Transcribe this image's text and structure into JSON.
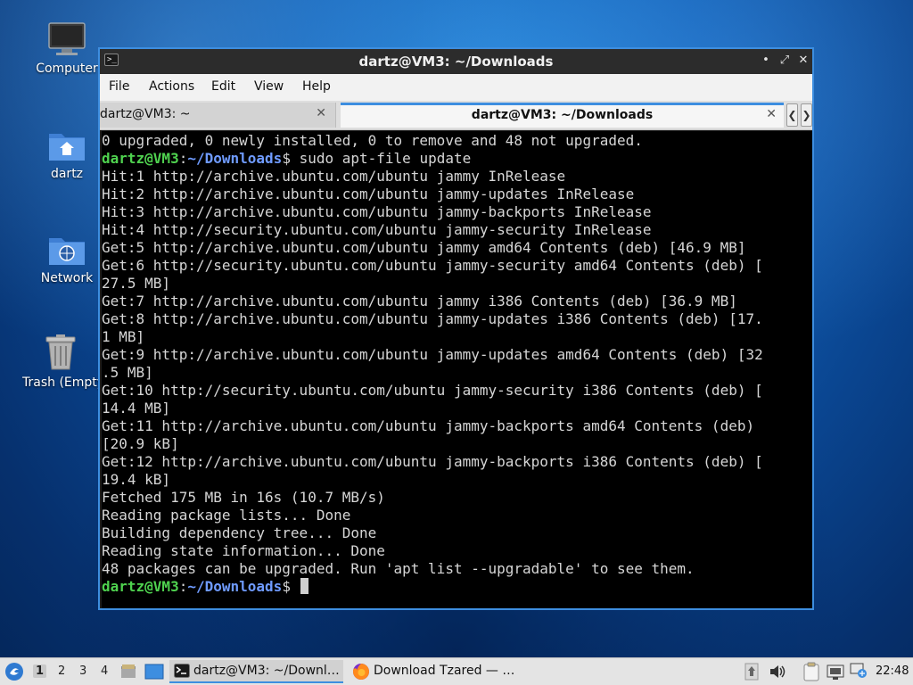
{
  "desktop": {
    "icons": [
      {
        "label": "Computer",
        "icon": "computer-icon"
      },
      {
        "label": "dartz",
        "icon": "home-folder-icon"
      },
      {
        "label": "Network",
        "icon": "network-folder-icon"
      },
      {
        "label": "Trash (Empty)",
        "icon": "trash-icon"
      }
    ]
  },
  "window": {
    "title": "dartz@VM3: ~/Downloads",
    "menu": [
      "File",
      "Actions",
      "Edit",
      "View",
      "Help"
    ],
    "tabs": [
      {
        "label": "dartz@VM3: ~",
        "active": false
      },
      {
        "label": "dartz@VM3: ~/Downloads",
        "active": true
      }
    ],
    "prompt": {
      "user_host": "dartz@VM3",
      "separator": ":",
      "path": "~/Downloads",
      "symbol": "$"
    },
    "terminal": {
      "line_00": "0 upgraded, 0 newly installed, 0 to remove and 48 not upgraded.",
      "line_01_cmd": " sudo apt-file update",
      "line_02": "Hit:1 http://archive.ubuntu.com/ubuntu jammy InRelease",
      "line_03": "Hit:2 http://archive.ubuntu.com/ubuntu jammy-updates InRelease",
      "line_04": "Hit:3 http://archive.ubuntu.com/ubuntu jammy-backports InRelease",
      "line_05": "Hit:4 http://security.ubuntu.com/ubuntu jammy-security InRelease",
      "line_06": "Get:5 http://archive.ubuntu.com/ubuntu jammy amd64 Contents (deb) [46.9 MB]",
      "line_07": "Get:6 http://security.ubuntu.com/ubuntu jammy-security amd64 Contents (deb) [",
      "line_08": "27.5 MB]",
      "line_09": "Get:7 http://archive.ubuntu.com/ubuntu jammy i386 Contents (deb) [36.9 MB]",
      "line_10": "Get:8 http://archive.ubuntu.com/ubuntu jammy-updates i386 Contents (deb) [17.",
      "line_11": "1 MB]",
      "line_12": "Get:9 http://archive.ubuntu.com/ubuntu jammy-updates amd64 Contents (deb) [32",
      "line_13": ".5 MB]",
      "line_14": "Get:10 http://security.ubuntu.com/ubuntu jammy-security i386 Contents (deb) [",
      "line_15": "14.4 MB]",
      "line_16": "Get:11 http://archive.ubuntu.com/ubuntu jammy-backports amd64 Contents (deb)",
      "line_17": "[20.9 kB]",
      "line_18": "Get:12 http://archive.ubuntu.com/ubuntu jammy-backports i386 Contents (deb) [",
      "line_19": "19.4 kB]",
      "line_20": "Fetched 175 MB in 16s (10.7 MB/s)",
      "line_21": "Reading package lists... Done",
      "line_22": "Building dependency tree... Done",
      "line_23": "Reading state information... Done",
      "line_24": "48 packages can be upgraded. Run 'apt list --upgradable' to see them."
    }
  },
  "taskbar": {
    "workspaces": [
      "1",
      "2",
      "3",
      "4"
    ],
    "active_workspace": "1",
    "tasks": [
      {
        "label": "dartz@VM3: ~/Downl…",
        "icon": "terminal-icon"
      },
      {
        "label": "Download Tzared — …",
        "icon": "firefox-icon"
      }
    ],
    "clock": "22:48"
  },
  "colors": {
    "accent": "#3d8ee0",
    "prompt_user": "#4fd24f",
    "prompt_path": "#6f9bff",
    "terminal_bg": "#000000",
    "terminal_fg": "#d6d6d6"
  }
}
